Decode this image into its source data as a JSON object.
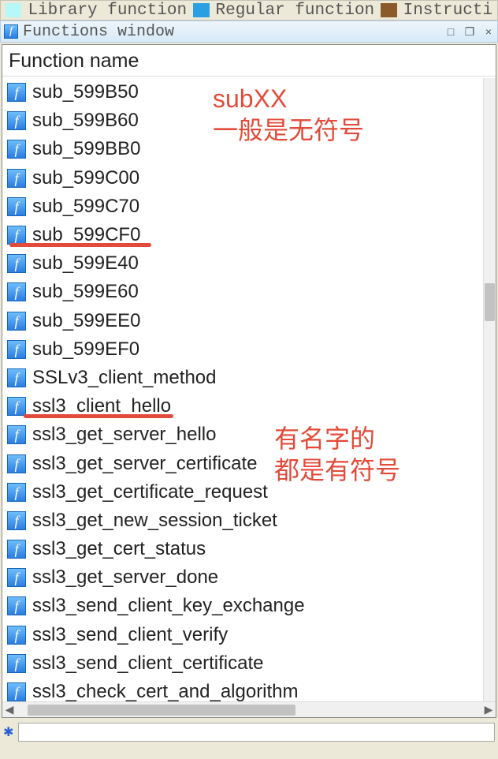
{
  "legend": {
    "library": "Library function",
    "regular": "Regular function",
    "instruction": "Instructi"
  },
  "panel": {
    "title": "Functions window",
    "minimize_sym": "□",
    "restore_sym": "❐",
    "close_sym": "×"
  },
  "list": {
    "header": "Function name",
    "functions": [
      "sub_599B50",
      "sub_599B60",
      "sub_599BB0",
      "sub_599C00",
      "sub_599C70",
      "sub_599CF0",
      "sub_599E40",
      "sub_599E60",
      "sub_599EE0",
      "sub_599EF0",
      "SSLv3_client_method",
      "ssl3_client_hello",
      "ssl3_get_server_hello",
      "ssl3_get_server_certificate",
      "ssl3_get_certificate_request",
      "ssl3_get_new_session_ticket",
      "ssl3_get_cert_status",
      "ssl3_get_server_done",
      "ssl3_send_client_key_exchange",
      "ssl3_send_client_verify",
      "ssl3_send_client_certificate",
      "ssl3_check_cert_and_algorithm"
    ]
  },
  "annotations": {
    "a1_line1": "subXX",
    "a1_line2": "一般是无符号",
    "a2_line1": "有名字的",
    "a2_line2": "都是有符号"
  },
  "bottom": {
    "star": "✱",
    "value": ""
  },
  "icons": {
    "f_glyph": "f"
  },
  "colors": {
    "annotation": "#e24b3a",
    "library_swatch": "#b8f7f7",
    "regular_swatch": "#2aa0e3",
    "instruction_swatch": "#8b5a2b"
  }
}
